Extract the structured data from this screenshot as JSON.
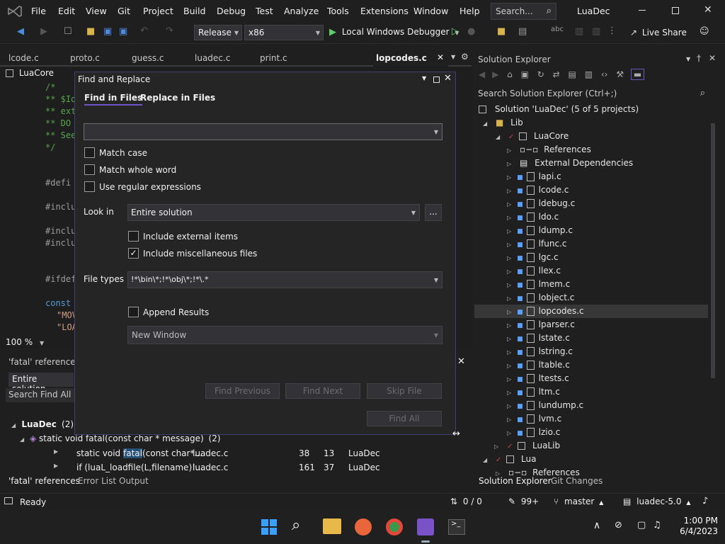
{
  "menu": [
    "File",
    "Edit",
    "View",
    "Git",
    "Project",
    "Build",
    "Debug",
    "Test",
    "Analyze",
    "Tools",
    "Extensions",
    "Window",
    "Help"
  ],
  "search_placeholder": "Search...",
  "solution_name": "LuaDec",
  "toolbar": {
    "config": "Release",
    "platform": "x86",
    "debugger": "Local Windows Debugger",
    "live_share": "Live Share"
  },
  "doc_tabs": [
    "lcode.c",
    "proto.c",
    "guess.c",
    "luadec.c",
    "print.c",
    "lopcodes.c"
  ],
  "editor": {
    "nav": "LuaCore",
    "zoom": "100 %",
    "lines": [
      "/*",
      "** $Id",
      "** ext",
      "** DO",
      "** See",
      "*/",
      "#defi",
      "#inclu",
      "#inclu",
      "#inclu",
      "#ifdef",
      "const",
      "\"MOV",
      "\"LOA"
    ]
  },
  "find_dialog": {
    "title": "Find and Replace",
    "tab_find": "Find in Files",
    "tab_replace": "Replace in Files",
    "find_value": "",
    "match_case": "Match case",
    "match_whole_word": "Match whole word",
    "use_regex": "Use regular expressions",
    "look_in_label": "Look in",
    "look_in_value": "Entire solution",
    "browse": "...",
    "include_external": "Include external items",
    "include_misc": "Include miscellaneous files",
    "file_types_label": "File types",
    "file_types_value": "!*\\bin\\*;!*\\obj\\*;!*\\.*",
    "append_results": "Append Results",
    "result_window": "New Window",
    "find_previous": "Find Previous",
    "find_next": "Find Next",
    "skip_file": "Skip File",
    "find_all": "Find All"
  },
  "refs_panel": {
    "title": "'fatal' references -",
    "scope": "Entire solution",
    "search": "Search Find All Re",
    "group": "LuaDec",
    "group_count": "(2)",
    "symbol": "static void fatal(const char * message)",
    "symbol_count": "(2)",
    "rows": [
      {
        "code_pre": "static void ",
        "code_hl": "fatal",
        "code_post": "(const char*...",
        "file": "luadec.c",
        "line": "38",
        "col": "13",
        "project": "LuaDec"
      },
      {
        "code_pre": "if (luaL_loadfile(L,filename)!...",
        "code_hl": "",
        "code_post": "",
        "file": "luadec.c",
        "line": "161",
        "col": "37",
        "project": "LuaDec"
      }
    ],
    "tabs": [
      "'fatal' references",
      "Error List",
      "Output"
    ]
  },
  "solution_explorer": {
    "title": "Solution Explorer",
    "search": "Search Solution Explorer (Ctrl+;)",
    "root": "Solution 'LuaDec' (5 of 5 projects)",
    "lib": "Lib",
    "luacore": "LuaCore",
    "references": "References",
    "external_deps": "External Dependencies",
    "files": [
      "lapi.c",
      "lcode.c",
      "ldebug.c",
      "ldo.c",
      "ldump.c",
      "lfunc.c",
      "lgc.c",
      "llex.c",
      "lmem.c",
      "lobject.c",
      "lopcodes.c",
      "lparser.c",
      "lstate.c",
      "lstring.c",
      "ltable.c",
      "ltests.c",
      "ltm.c",
      "lundump.c",
      "lvm.c",
      "lzio.c"
    ],
    "selected_file": "lopcodes.c",
    "lualib": "LuaLib",
    "lua": "Lua",
    "lua_refs": "References",
    "bottom_tabs": [
      "Solution Explorer",
      "Git Changes"
    ]
  },
  "status": {
    "ready": "Ready",
    "updown": "0 / 0",
    "edits": "99+",
    "branch": "master",
    "repo": "luadec-5.0"
  },
  "clock": {
    "time": "1:00 PM",
    "date": "6/4/2023"
  },
  "colors": {
    "accent": "#6f54c8",
    "selection": "#373737",
    "dialog_border": "#3f3f70",
    "play": "#5fd068"
  }
}
